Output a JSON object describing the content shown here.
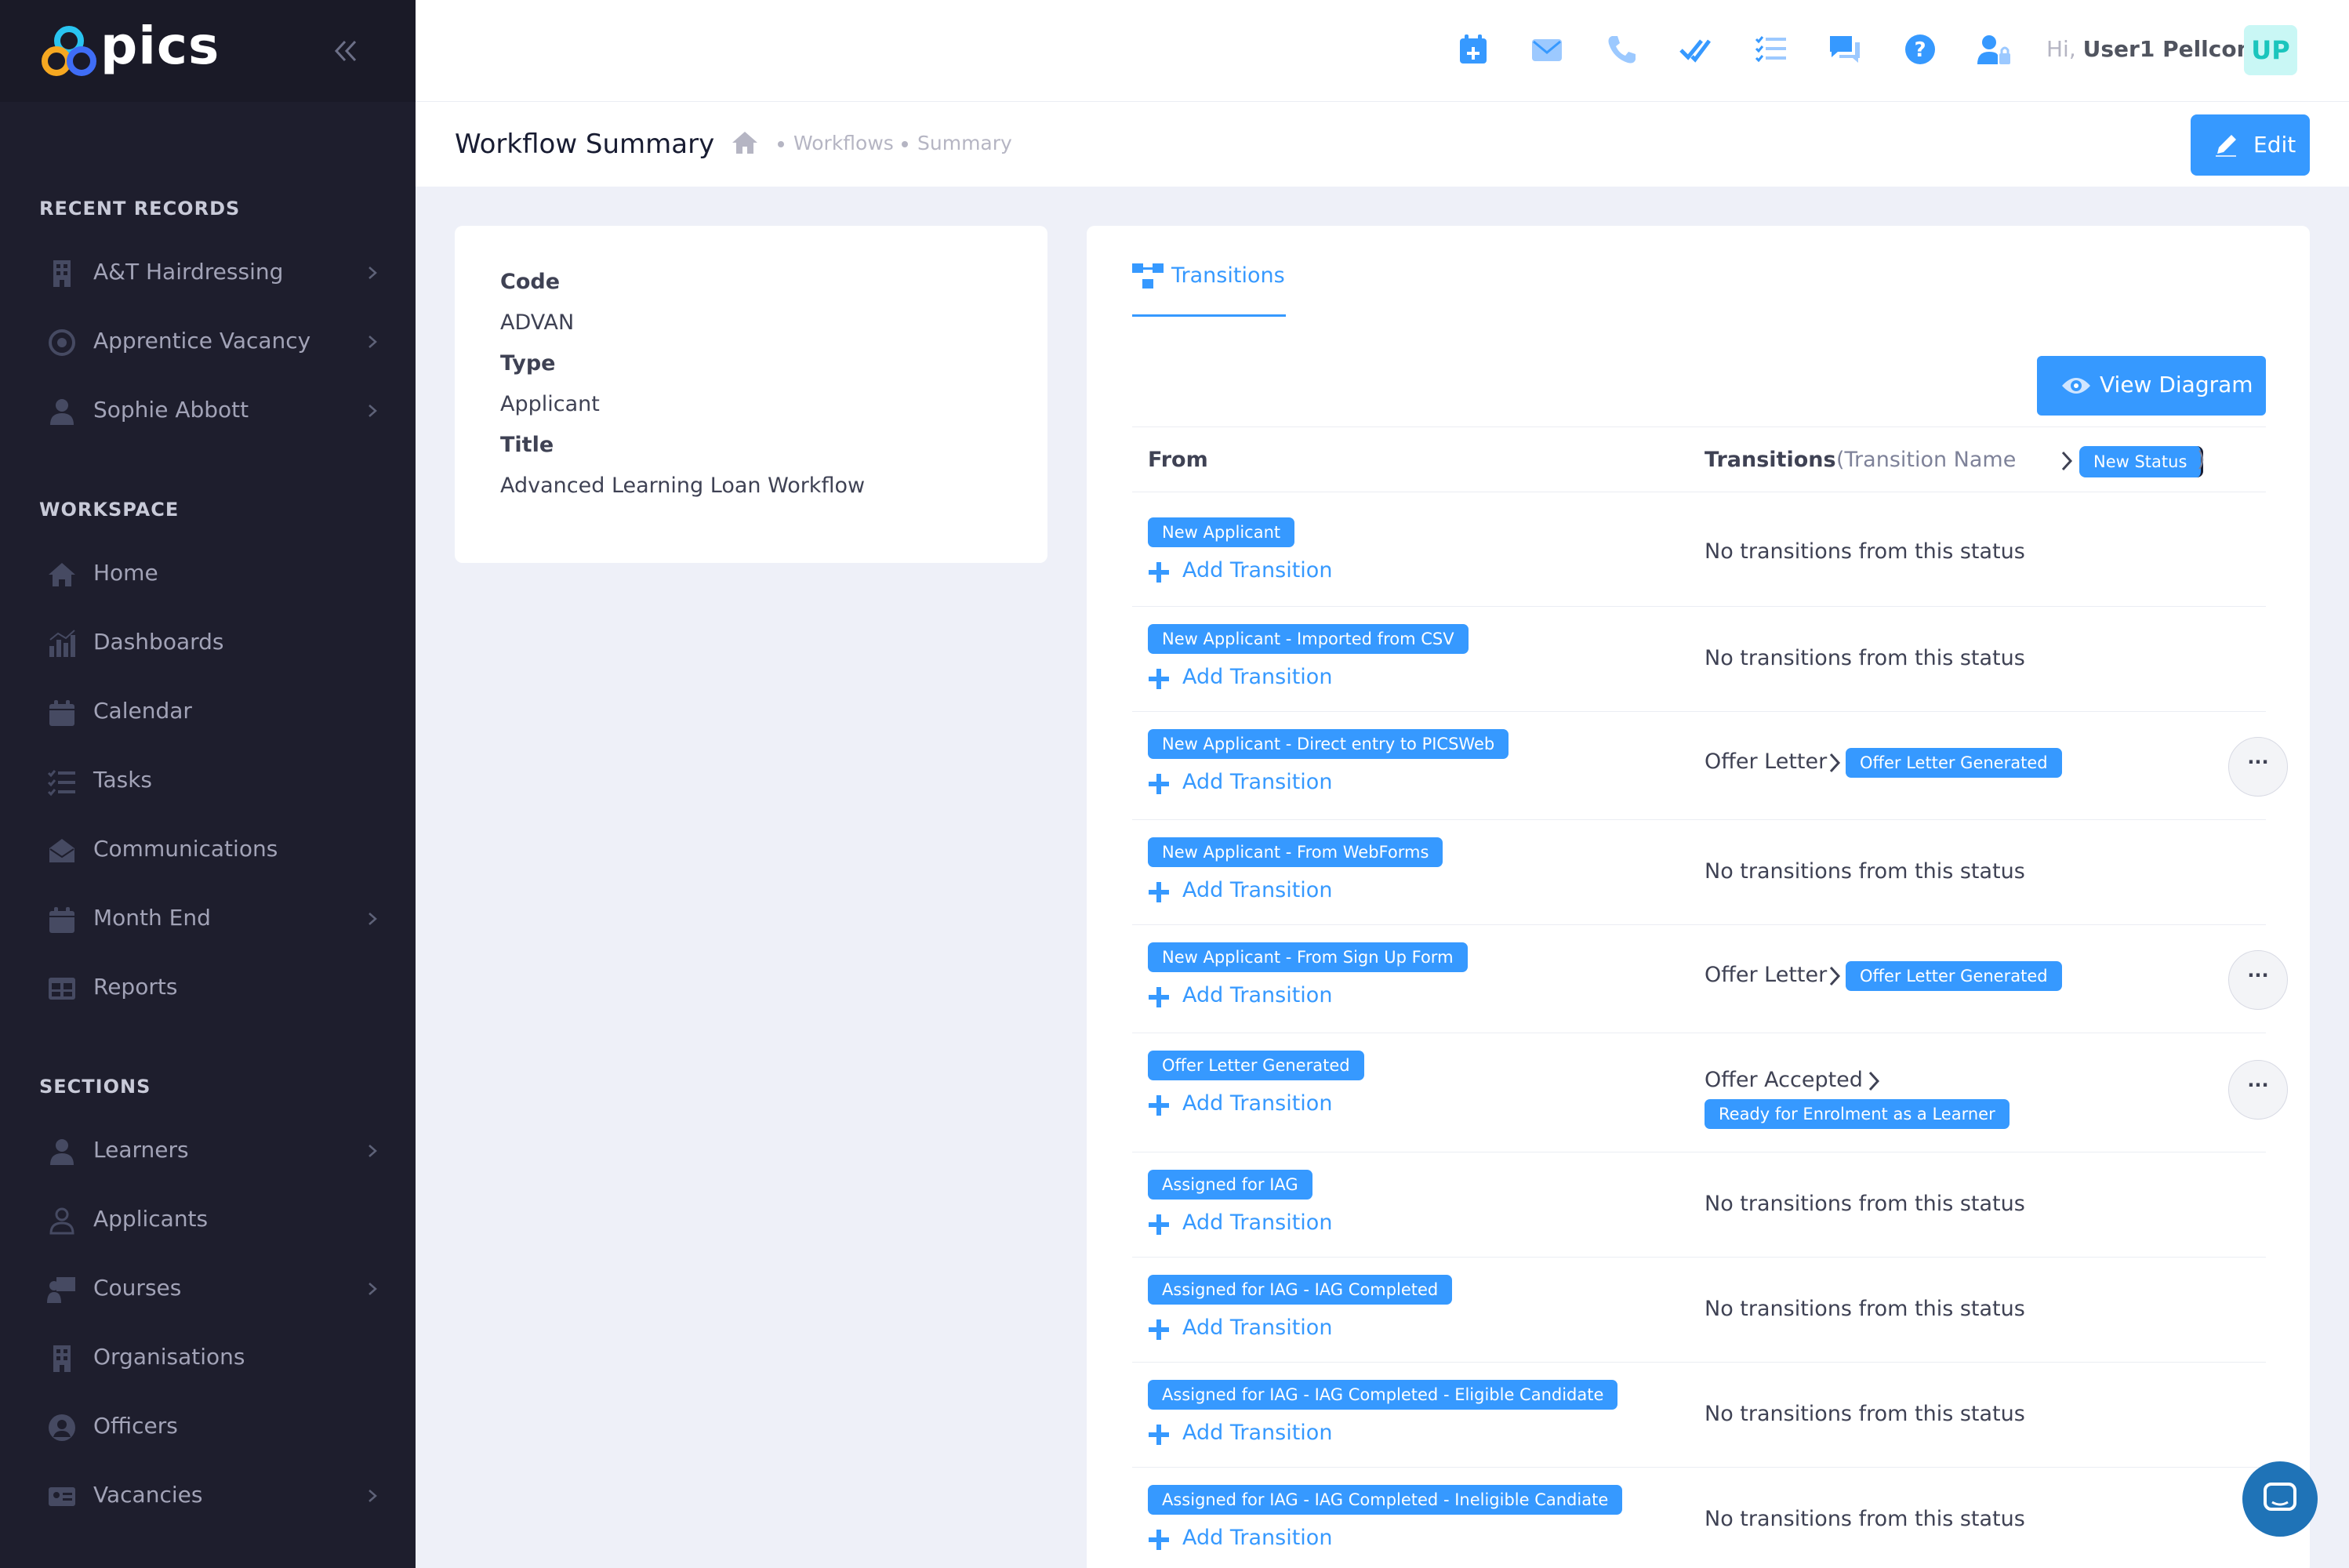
{
  "app": {
    "brand": "pics"
  },
  "sidebar": {
    "sections": [
      "RECENT RECORDS",
      "WORKSPACE",
      "SECTIONS"
    ],
    "recent": [
      {
        "label": "A&T Hairdressing",
        "icon": "building-icon"
      },
      {
        "label": "Apprentice Vacancy",
        "icon": "target-icon"
      },
      {
        "label": "Sophie Abbott",
        "icon": "user-icon"
      }
    ],
    "workspace": [
      {
        "label": "Home",
        "icon": "home-icon"
      },
      {
        "label": "Dashboards",
        "icon": "chart-bar-icon"
      },
      {
        "label": "Calendar",
        "icon": "calendar-icon"
      },
      {
        "label": "Tasks",
        "icon": "tasks-icon"
      },
      {
        "label": "Communications",
        "icon": "envelope-open-icon"
      },
      {
        "label": "Month End",
        "icon": "calendar-icon"
      },
      {
        "label": "Reports",
        "icon": "table-icon"
      }
    ],
    "sections_items": [
      {
        "label": "Learners",
        "icon": "user-icon"
      },
      {
        "label": "Applicants",
        "icon": "user-outline-icon"
      },
      {
        "label": "Courses",
        "icon": "teacher-icon"
      },
      {
        "label": "Organisations",
        "icon": "building-icon"
      },
      {
        "label": "Officers",
        "icon": "user-circle-icon"
      },
      {
        "label": "Vacancies",
        "icon": "id-card-icon"
      }
    ]
  },
  "header": {
    "greeting_prefix": "Hi,",
    "user_name": "User1 Pellcomp",
    "avatar_initials": "UP",
    "icons": [
      "calendar-plus-icon",
      "envelope-icon",
      "phone-icon",
      "double-check-icon",
      "checklist-icon",
      "chat-icon",
      "help-icon",
      "user-lock-icon"
    ]
  },
  "subheader": {
    "title": "Workflow Summary",
    "breadcrumbs": [
      "Workflows",
      "Summary"
    ],
    "edit_label": "Edit"
  },
  "info": {
    "code_label": "Code",
    "code": "ADVAN",
    "type_label": "Type",
    "type": "Applicant",
    "title_label": "Title",
    "title": "Advanced Learning Loan Workflow"
  },
  "transitions": {
    "tab_label": "Transitions",
    "view_diagram_label": "View Diagram",
    "col_from": "From",
    "col_transitions": "Transitions",
    "legend_prefix": "(Transition Name",
    "legend_pill": "New Status",
    "legend_suffix": ")",
    "add_label": "Add Transition",
    "none_text": "No transitions from this status",
    "more_label": "···",
    "rows": [
      {
        "from": "New Applicant"
      },
      {
        "from": "New Applicant - Imported from CSV"
      },
      {
        "from": "New Applicant - Direct entry to PICSWeb",
        "name": "Offer Letter",
        "to": "Offer Letter Generated"
      },
      {
        "from": "New Applicant - From WebForms"
      },
      {
        "from": "New Applicant - From Sign Up Form",
        "name": "Offer Letter",
        "to": "Offer Letter Generated"
      },
      {
        "from": "Offer Letter Generated",
        "name": "Offer Accepted",
        "to": "Ready for Enrolment as a Learner"
      },
      {
        "from": "Assigned for IAG"
      },
      {
        "from": "Assigned for IAG - IAG Completed"
      },
      {
        "from": "Assigned for IAG - IAG Completed - Eligible Candidate"
      },
      {
        "from": "Assigned for IAG - IAG Completed - Ineligible Candiate"
      }
    ]
  },
  "colors": {
    "primary": "#3699ff",
    "sidebar": "#1e1e2d",
    "page_bg": "#eef0f8"
  }
}
